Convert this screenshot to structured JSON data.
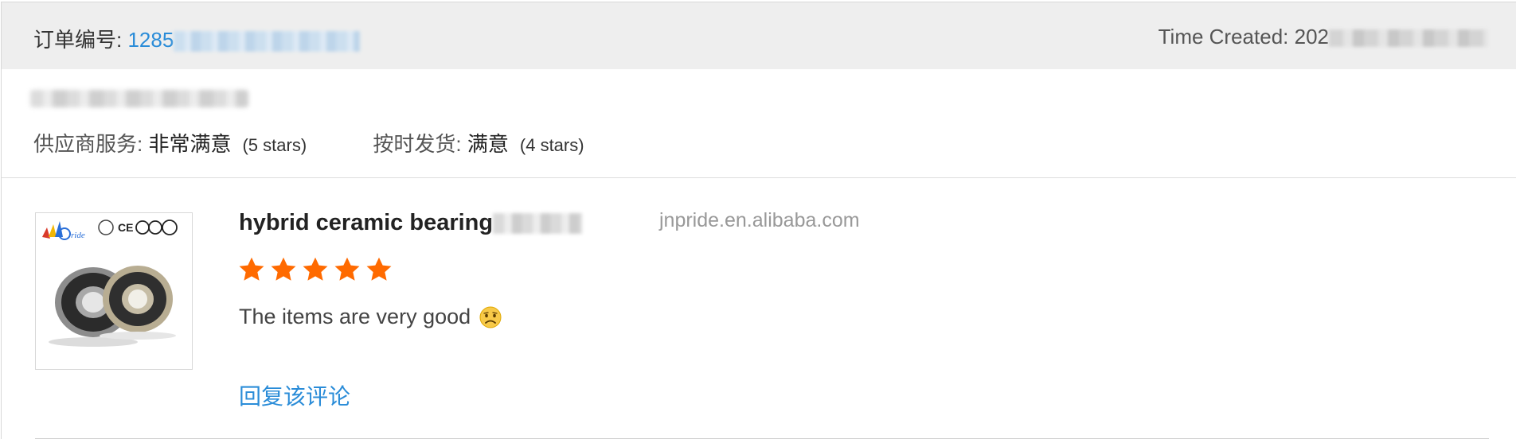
{
  "header": {
    "order_label": "订单编号",
    "separator": ": ",
    "order_number_visible": "1285",
    "time_label": "Time Created: ",
    "time_visible": "202"
  },
  "ratings": [
    {
      "label": "供应商服务",
      "separator": ": ",
      "value": "非常满意",
      "stars_text": "(5 stars)"
    },
    {
      "label": "按时发货",
      "separator": ": ",
      "value": "满意",
      "stars_text": "(4 stars)"
    }
  ],
  "product": {
    "title": "hybrid ceramic bearing",
    "store": "jnpride.en.alibaba.com",
    "rating": 5,
    "review": "The items are very good",
    "reply_label": "回复该评论"
  },
  "colors": {
    "link": "#2a8cd8",
    "star": "#ff6a00",
    "header_bg": "#eeeeee"
  },
  "icons": {
    "star": "star-icon",
    "emoji": "sad-face-icon"
  }
}
